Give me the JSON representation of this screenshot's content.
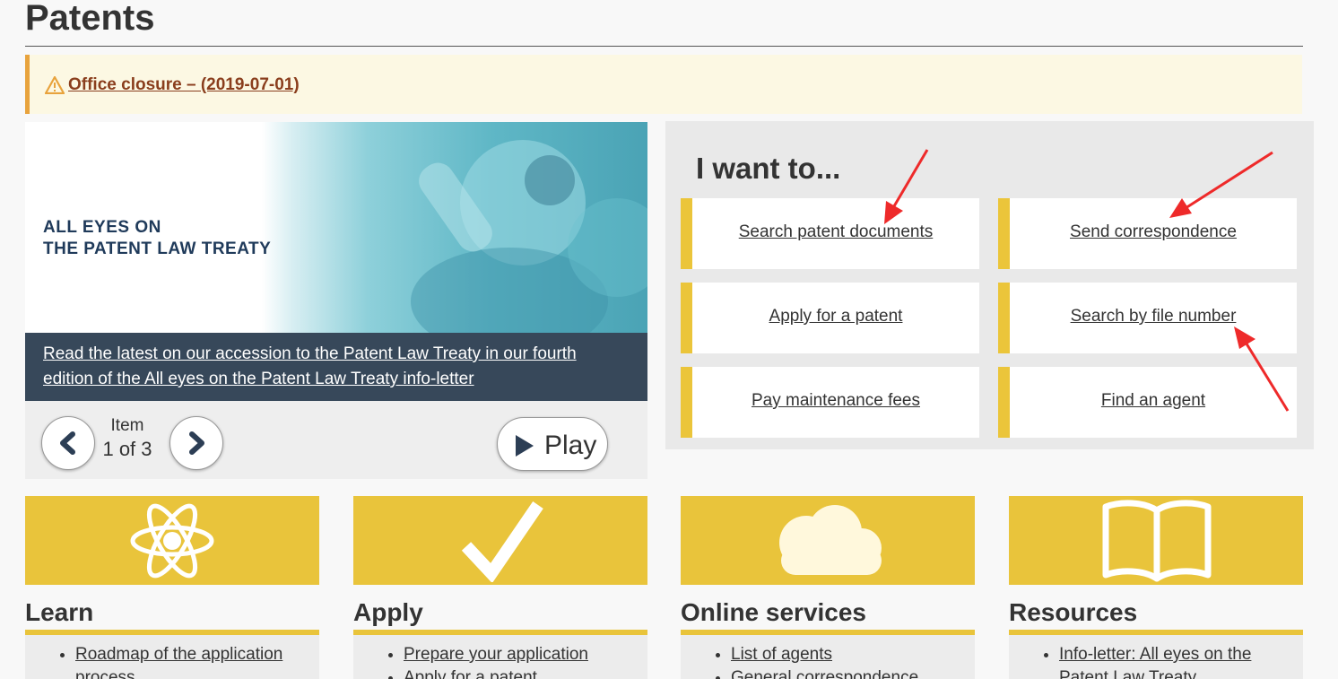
{
  "page": {
    "title": "Patents"
  },
  "alert": {
    "link_text": "Office closure – (2019-07-01)",
    "accent_color": "#e8a33d"
  },
  "carousel": {
    "banner_text": "ALL EYES ON\nTHE PATENT LAW TREATY",
    "caption": "Read the latest on our accession to the Patent Law Treaty in our fourth edition of the All eyes on the Patent Law Treaty info-letter",
    "item_label": "Item",
    "item_count": "1 of 3",
    "play_label": "Play",
    "prev_icon": "chevron-left-icon",
    "next_icon": "chevron-right-icon"
  },
  "iwant": {
    "heading": "I want to...",
    "tasks": [
      {
        "label": "Search patent documents"
      },
      {
        "label": "Send correspondence"
      },
      {
        "label": "Apply for a patent"
      },
      {
        "label": "Search by file number"
      },
      {
        "label": "Pay maintenance fees"
      },
      {
        "label": "Find an agent"
      }
    ],
    "accent_color": "#ebc53a"
  },
  "annotations": {
    "color": "#ee2a2a"
  },
  "tiles": [
    {
      "title": "Learn",
      "icon": "atom-icon",
      "links": [
        "Roadmap of the application",
        "process"
      ]
    },
    {
      "title": "Apply",
      "icon": "checkmark-icon",
      "links": [
        "Prepare your application",
        "Apply for a patent"
      ]
    },
    {
      "title": "Online services",
      "icon": "cloud-icon",
      "links": [
        "List of agents",
        "General correspondence"
      ]
    },
    {
      "title": "Resources",
      "icon": "open-book-icon",
      "links": [
        "Info-letter: All eyes on the",
        "Patent Law Treaty"
      ]
    }
  ]
}
